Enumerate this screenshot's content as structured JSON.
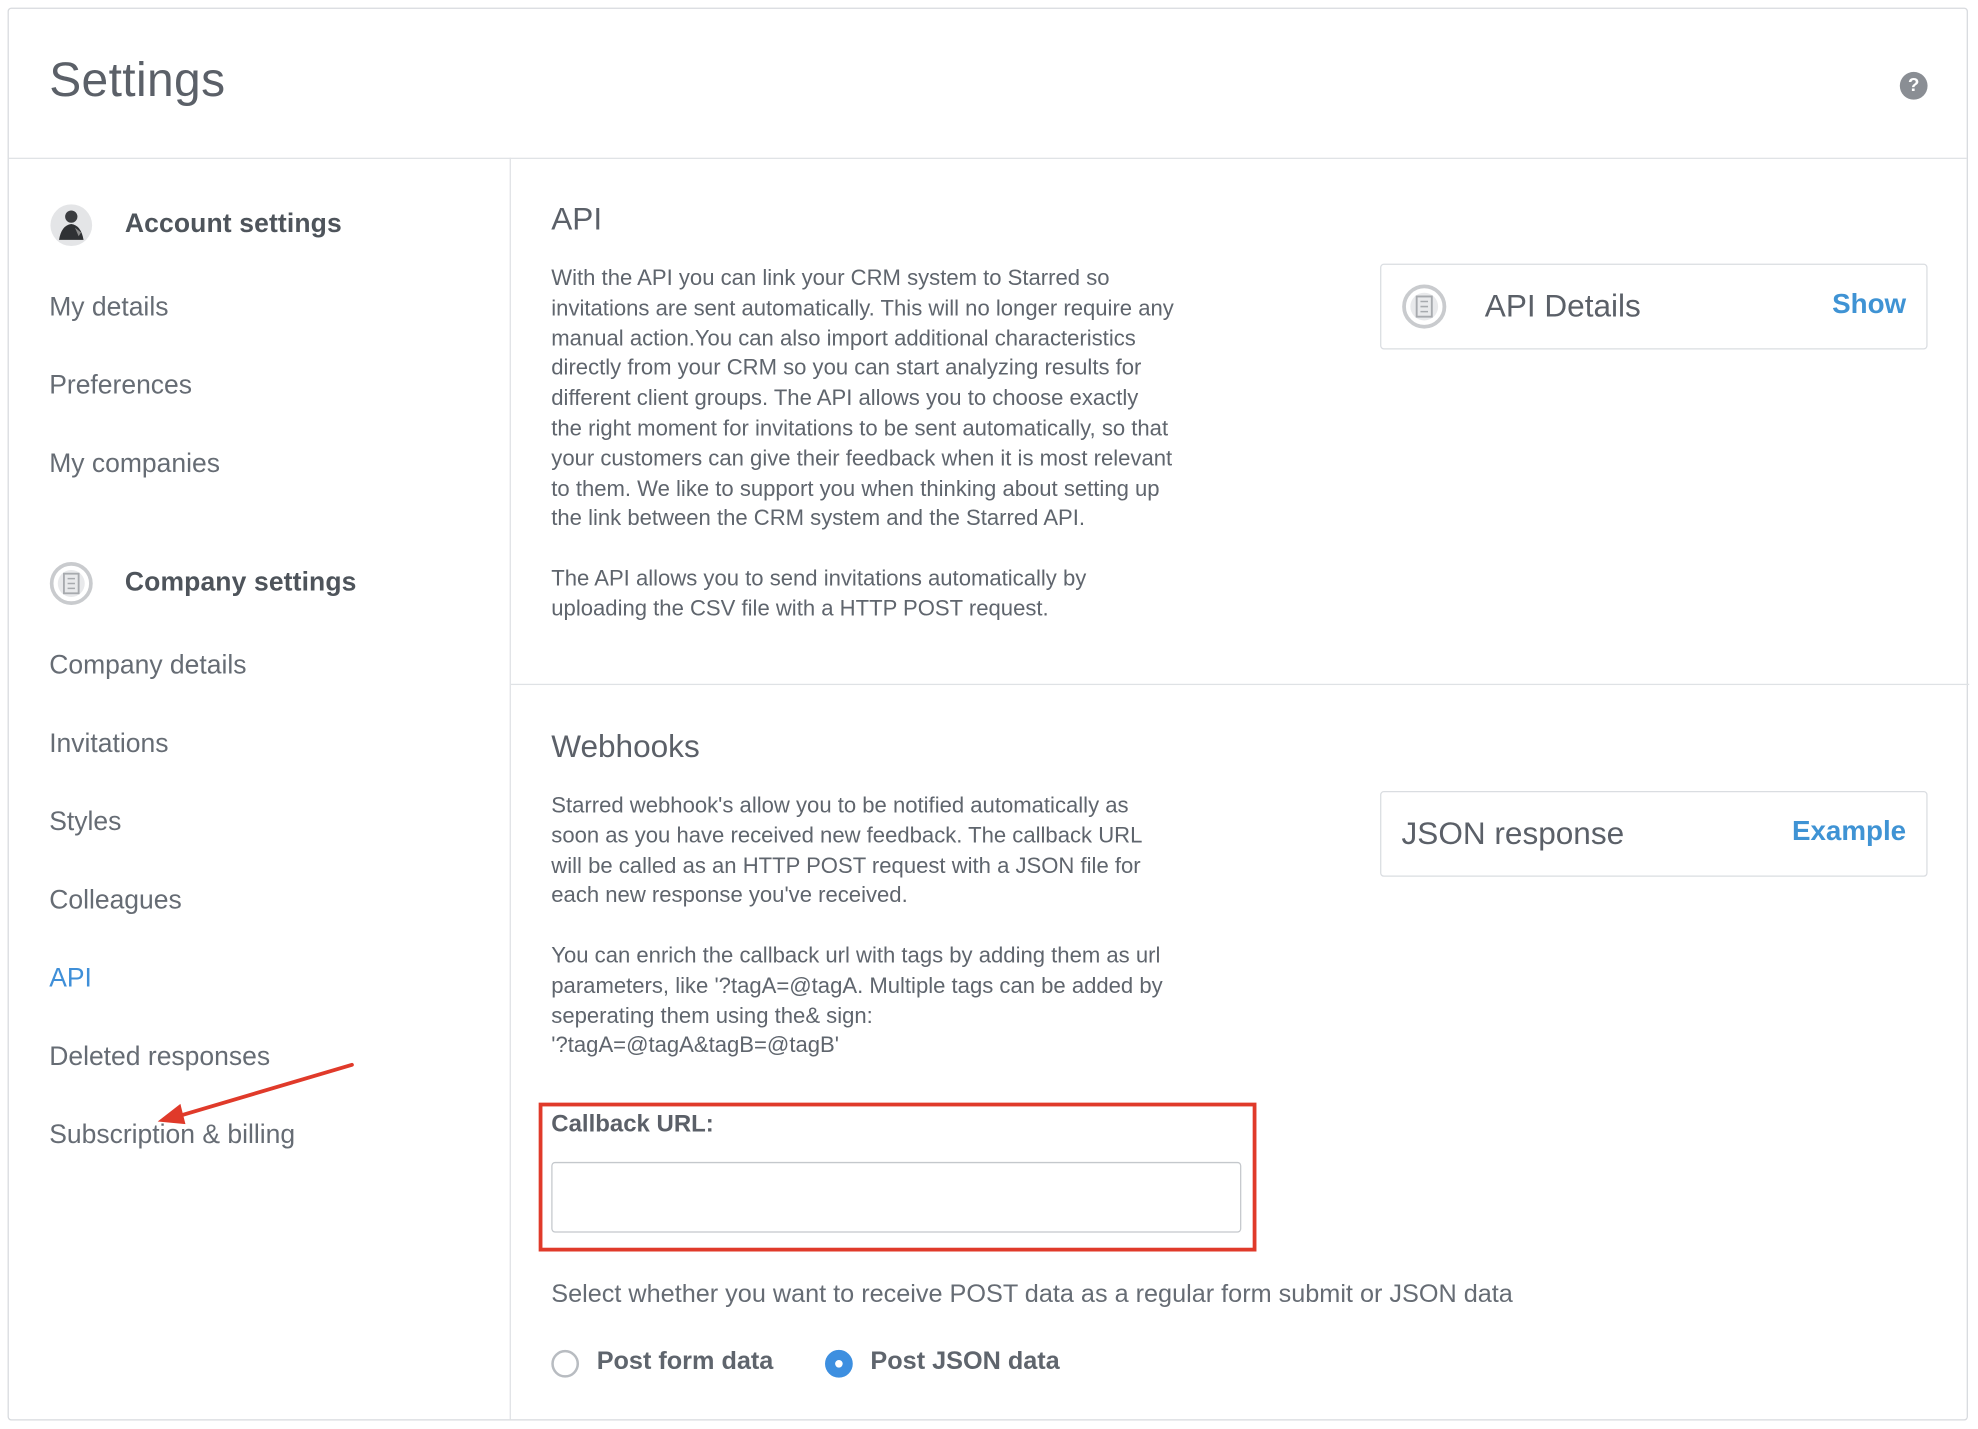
{
  "header": {
    "title": "Settings",
    "help_icon": "question-circle-icon",
    "help_glyph": "?"
  },
  "sidebar": {
    "account_group": {
      "label": "Account settings",
      "icon": "user-avatar-icon",
      "items": [
        {
          "label": "My details"
        },
        {
          "label": "Preferences"
        },
        {
          "label": "My companies"
        }
      ]
    },
    "company_group": {
      "label": "Company settings",
      "icon": "building-icon",
      "items": [
        {
          "label": "Company details"
        },
        {
          "label": "Invitations"
        },
        {
          "label": "Styles"
        },
        {
          "label": "Colleagues"
        },
        {
          "label": "API",
          "active": true
        },
        {
          "label": "Deleted responses"
        },
        {
          "label": "Subscription & billing"
        }
      ]
    },
    "active_color": "#3f8fd8"
  },
  "api_section": {
    "title": "API",
    "paragraph1_lines": [
      "With the API you can link your CRM system to Starred so",
      "invitations are sent automatically. This will no longer require any",
      "manual action.You can also import additional characteristics",
      "directly from your CRM so you can start analyzing results for",
      "different client groups. The API allows you to choose exactly",
      "the right moment for invitations to be sent automatically, so that",
      "your customers can give their feedback when it is most relevant",
      "to them. We like to support you when thinking about setting up",
      "the link between the CRM system and the Starred API."
    ],
    "paragraph2_lines": [
      "The API allows you to send invitations automatically by",
      "uploading the CSV file with a HTTP POST request."
    ],
    "card": {
      "icon": "building-icon",
      "title": "API Details",
      "link": "Show"
    }
  },
  "webhooks_section": {
    "title": "Webhooks",
    "paragraph1_lines": [
      "Starred webhook's allow you to be notified automatically as",
      "soon as you have received new feedback. The callback URL",
      "will be called as an HTTP POST request with a JSON file for",
      "each new response you've received."
    ],
    "paragraph2_lines": [
      "You can enrich the callback url with tags by adding them as url",
      "parameters, like '?tagA=@tagA. Multiple tags can be added by",
      "seperating them using the& sign:",
      "'?tagA=@tagA&tagB=@tagB'"
    ],
    "card": {
      "title": "JSON response",
      "link": "Example"
    },
    "callback": {
      "label": "Callback URL:",
      "value": "",
      "placeholder": ""
    },
    "select_text": "Select whether you want to receive POST data as a regular form submit or JSON data",
    "options": [
      {
        "label": "Post form data",
        "selected": false
      },
      {
        "label": "Post JSON data",
        "selected": true
      }
    ]
  },
  "colors": {
    "link": "#3f93d4",
    "highlight": "#e03a2a",
    "radio_selected": "#3d8fe0"
  }
}
